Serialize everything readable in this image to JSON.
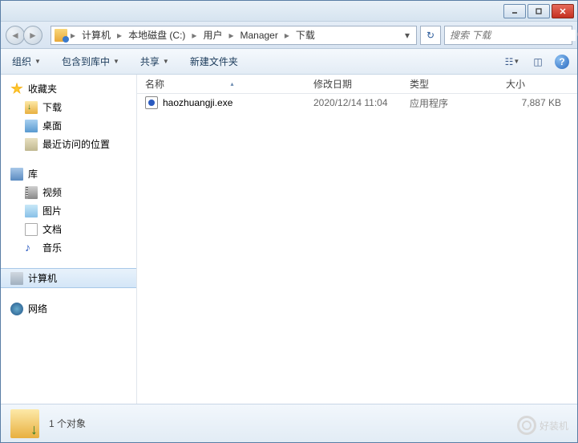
{
  "breadcrumb": [
    "计算机",
    "本地磁盘 (C:)",
    "用户",
    "Manager",
    "下载"
  ],
  "search": {
    "placeholder": "搜索 下载"
  },
  "toolbar": {
    "organize": "组织",
    "include": "包含到库中",
    "share": "共享",
    "newfolder": "新建文件夹"
  },
  "sidebar": {
    "favorites": {
      "label": "收藏夹",
      "items": [
        "下载",
        "桌面",
        "最近访问的位置"
      ]
    },
    "libraries": {
      "label": "库",
      "items": [
        "视频",
        "图片",
        "文档",
        "音乐"
      ]
    },
    "computer": {
      "label": "计算机"
    },
    "network": {
      "label": "网络"
    }
  },
  "columns": {
    "name": "名称",
    "date": "修改日期",
    "type": "类型",
    "size": "大小"
  },
  "files": [
    {
      "name": "haozhuangji.exe",
      "date": "2020/12/14 11:04",
      "type": "应用程序",
      "size": "7,887 KB"
    }
  ],
  "status": {
    "count": "1 个对象"
  },
  "watermark": "好装机"
}
